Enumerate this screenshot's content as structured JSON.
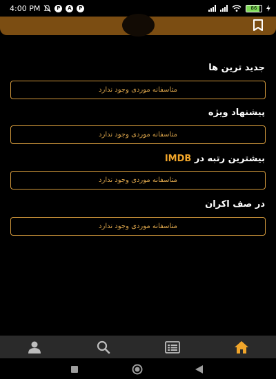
{
  "status_bar": {
    "time": "4:00 PM",
    "battery": "86",
    "icons": [
      "mute-icon",
      "p-app-icon",
      "a-app-icon",
      "p-app-icon",
      "signal-icon",
      "wifi-icon",
      "battery-icon",
      "charging-icon"
    ]
  },
  "header": {
    "icons": [
      "bookmark-icon"
    ]
  },
  "sections": [
    {
      "title": "جدید ترین ها",
      "empty_message": "متاسفانه موردی وجود ندارد"
    },
    {
      "title": "پیشنهاد ویژه",
      "empty_message": "متاسفانه موردی وجود ندارد"
    },
    {
      "title_prefix": "بیشترین رتبه در",
      "title_highlight": "IMDB",
      "empty_message": "متاسفانه موردی وجود ندارد"
    },
    {
      "title": "در صف اکران",
      "empty_message": "متاسفانه موردی وجود ندارد"
    }
  ],
  "bottom_nav": {
    "items": [
      "profile-icon",
      "search-icon",
      "list-icon",
      "home-icon"
    ],
    "active": "home-icon",
    "colors": {
      "active": "#f0a52a",
      "inactive": "#bdbdbd",
      "background": "#2a2a2a"
    }
  },
  "colors": {
    "header": "#7b4d12",
    "accent": "#f0a52a",
    "box_border": "#d49a3c"
  }
}
